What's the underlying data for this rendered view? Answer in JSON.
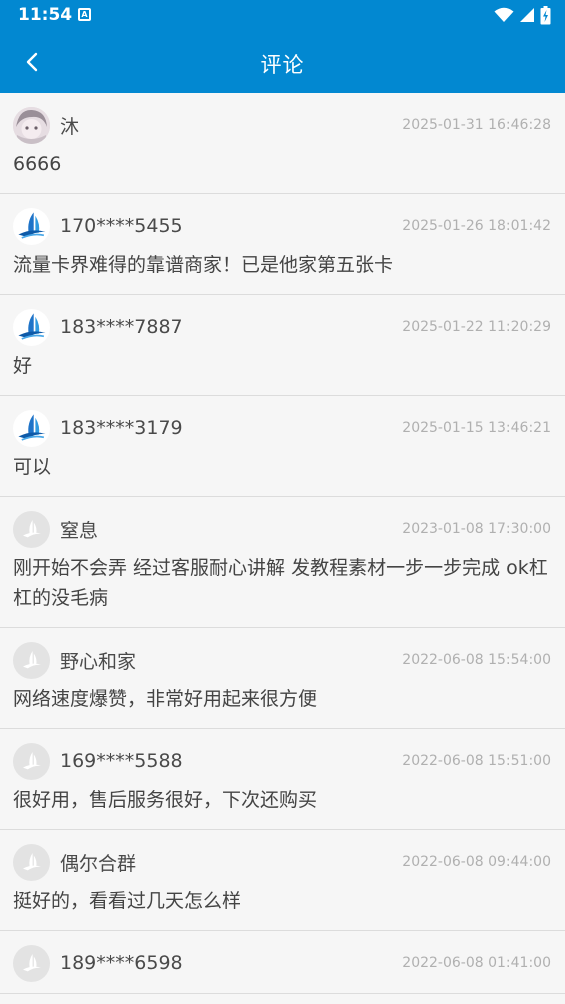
{
  "status_bar": {
    "time": "11:54",
    "notif_letter": "A"
  },
  "app_bar": {
    "title": "评论"
  },
  "comments": [
    {
      "user": "沐",
      "time": "2025-01-31 16:46:28",
      "text": "6666",
      "avatar": "photo"
    },
    {
      "user": "170****5455",
      "time": "2025-01-26 18:01:42",
      "text": "流量卡界难得的靠谱商家！已是他家第五张卡",
      "avatar": "brand"
    },
    {
      "user": "183****7887",
      "time": "2025-01-22 11:20:29",
      "text": "好",
      "avatar": "brand"
    },
    {
      "user": "183****3179",
      "time": "2025-01-15 13:46:21",
      "text": "可以",
      "avatar": "brand"
    },
    {
      "user": "窒息",
      "time": "2023-01-08 17:30:00",
      "text": "刚开始不会弄 经过客服耐心讲解 发教程素材一步一步完成 ok杠杠的没毛病",
      "avatar": "default"
    },
    {
      "user": "野心和家",
      "time": "2022-06-08 15:54:00",
      "text": "网络速度爆赞，非常好用起来很方便",
      "avatar": "default"
    },
    {
      "user": "169****5588",
      "time": "2022-06-08 15:51:00",
      "text": "很好用，售后服务很好，下次还购买",
      "avatar": "default"
    },
    {
      "user": "偶尔合群",
      "time": "2022-06-08 09:44:00",
      "text": "挺好的，看看过几天怎么样",
      "avatar": "default"
    },
    {
      "user": "189****6598",
      "time": "2022-06-08 01:41:00",
      "text": "",
      "avatar": "default"
    }
  ],
  "colors": {
    "primary": "#0288d1",
    "background": "#f6f6f6",
    "divider": "#dcdcdc",
    "time_text": "#b0b0b0"
  },
  "icons": {
    "back": "chevron-left-icon",
    "wifi": "wifi-icon",
    "signal": "signal-icon",
    "battery": "battery-icon"
  }
}
